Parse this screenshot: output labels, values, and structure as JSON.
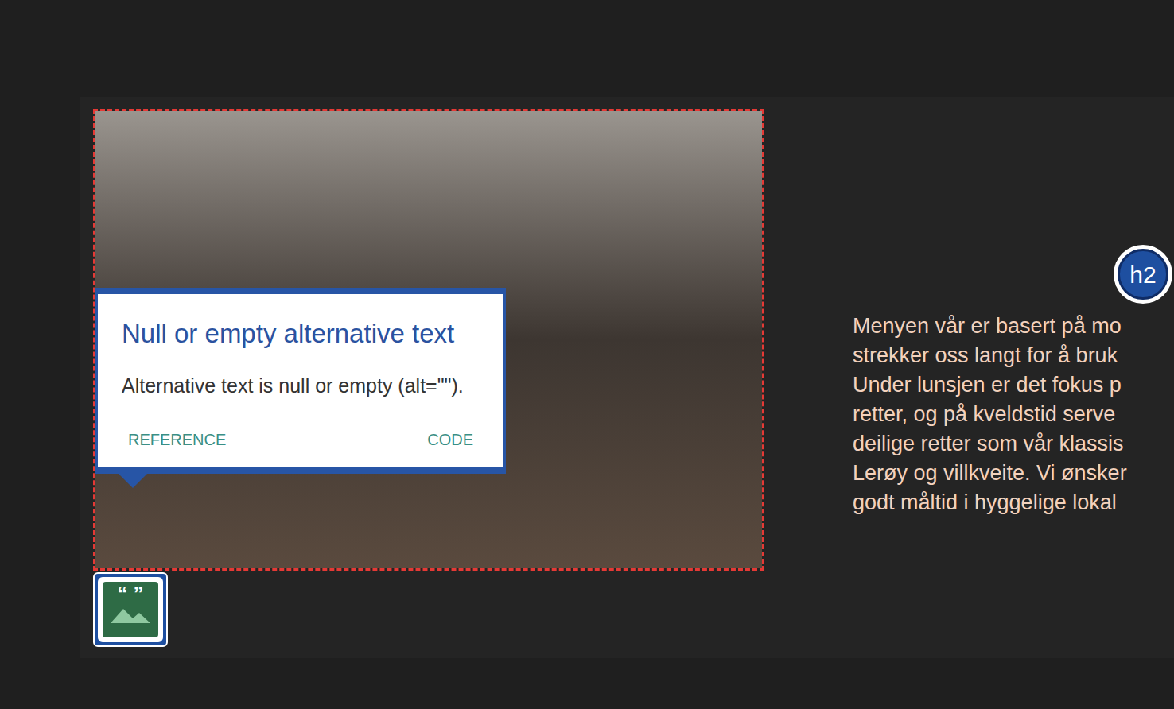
{
  "image": {
    "issue_flagged": true
  },
  "tooltip": {
    "title": "Null or empty alternative text",
    "body": "Alternative text is null or empty (alt=\"\").",
    "links": [
      "REFERENCE",
      "CODE"
    ]
  },
  "alt_badge": {
    "quote_marks": "“ ”",
    "selected": true
  },
  "heading_badge": {
    "label": "h2"
  },
  "paragraph": {
    "lines": [
      "Menyen vår er basert på mo",
      "strekker oss langt for å bruk",
      "Under lunsjen er det fokus p",
      "retter, og på kveldstid serve",
      "deilige retter som vår klassis",
      "Lerøy og villkveite. Vi ønsker",
      "godt måltid i hyggelige lokal"
    ]
  }
}
